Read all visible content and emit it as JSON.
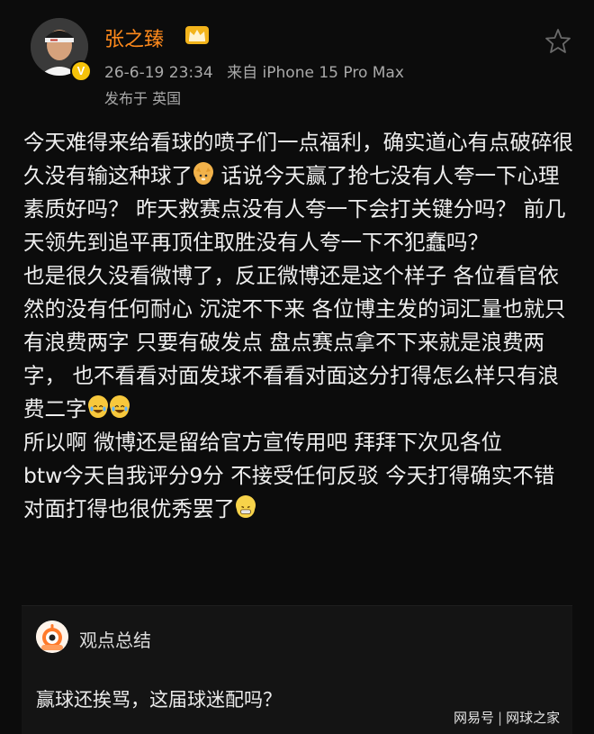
{
  "user": {
    "name": "张之臻",
    "date": "26-6-19 23:34",
    "source": "来自 iPhone 15 Pro Max",
    "location": "发布于 英国"
  },
  "post": {
    "paragraphs": [
      "今天难得来给看球的喷子们一点福利，确实道心有点破碎很久没有输这种球了",
      " 话说今天赢了抢七没有人夸一下心理素质好吗？ 昨天救赛点没有人夸一下会打关键分吗？ 前几天领先到追平再顶住取胜没有人夸一下不犯蠢吗？\n也是很久没看微博了，反正微博还是这个样子 各位看官依然的没有任何耐心 沉淀不下来 各位博主发的词汇量也就只有浪费两字 只要有破发点 盘点赛点拿不下来就是浪费两字， 也不看看对面发球不看看对面这分打得怎么样只有浪费二字",
      "\n所以啊 微博还是留给官方宣传用吧 拜拜下次见各位\nbtw今天自我评分9分 不接受任何反驳 今天打得确实不错 对面打得也很优秀罢了"
    ]
  },
  "summary": {
    "title": "观点总结",
    "text": "赢球还挨骂，这届球迷配吗？"
  },
  "watermark": {
    "left": "网易号",
    "sep": "|",
    "right": "网球之家"
  },
  "colors": {
    "username": "#ff8a1c",
    "background": "#0c0c0c",
    "verified_badge": "#f6c30a"
  },
  "icons": [
    "crown-icon",
    "star-icon",
    "verified-badge-icon",
    "robot-avatar-icon"
  ]
}
